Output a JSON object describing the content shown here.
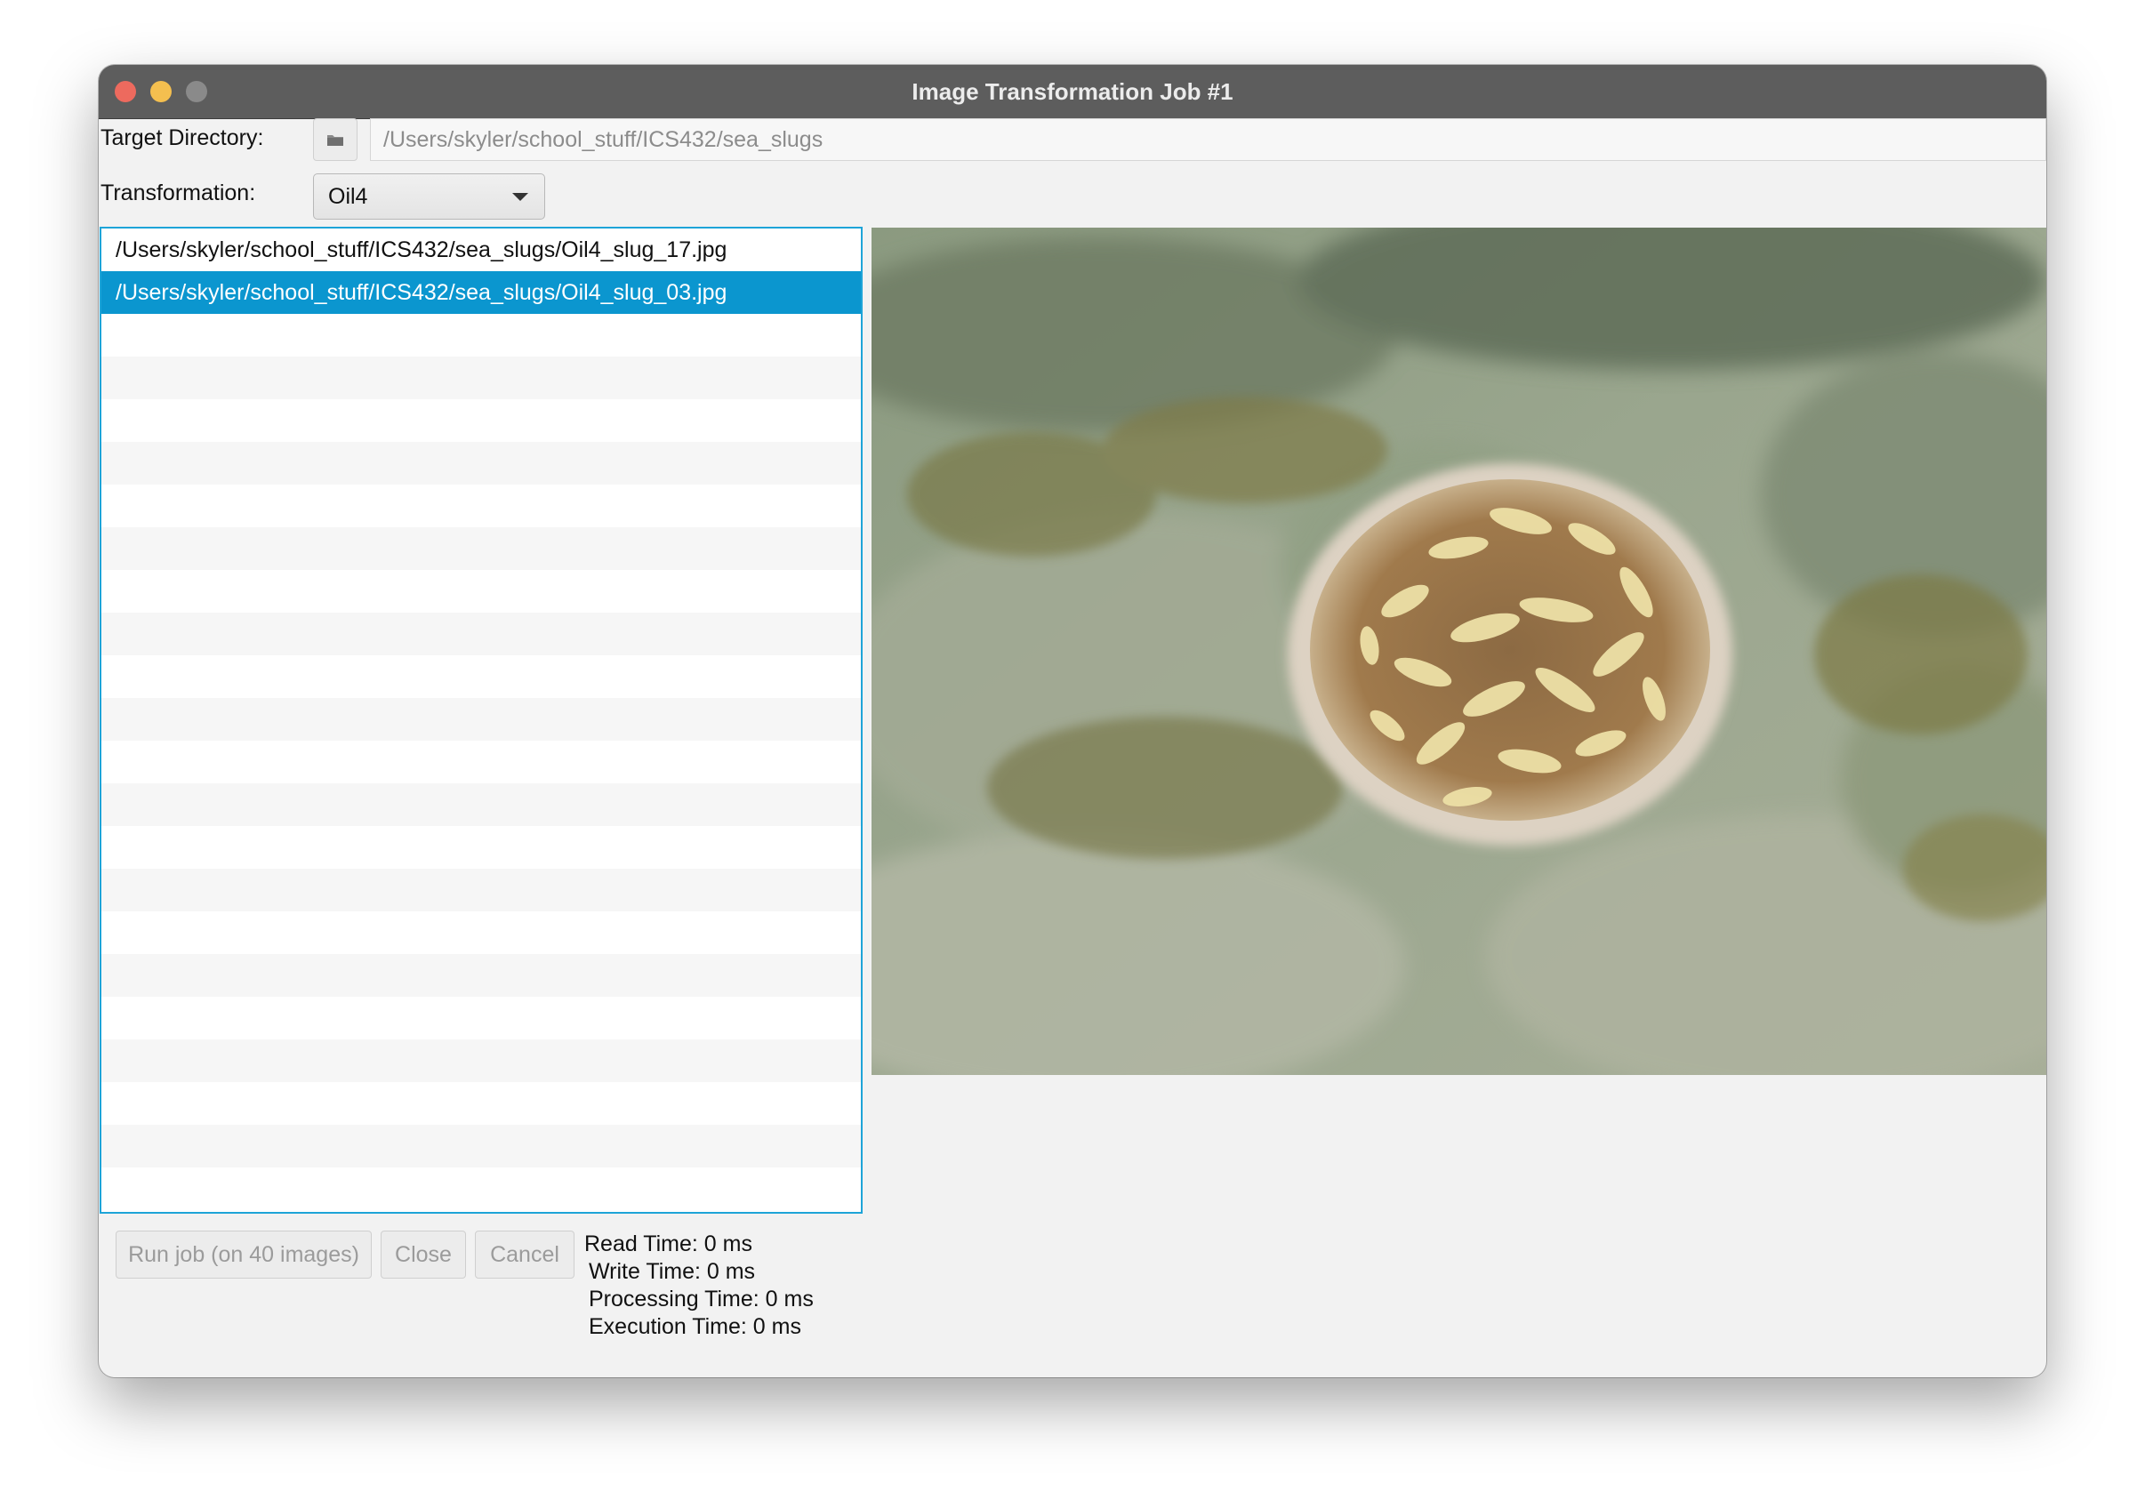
{
  "window": {
    "title": "Image Transformation Job #1"
  },
  "target_directory": {
    "label": "Target Directory:",
    "button_icon": "folder-icon",
    "value": "/Users/skyler/school_stuff/ICS432/sea_slugs"
  },
  "transformation": {
    "label": "Transformation:",
    "selected": "Oil4"
  },
  "file_list": {
    "items": [
      {
        "path": "/Users/skyler/school_stuff/ICS432/sea_slugs/Oil4_slug_17.jpg",
        "selected": false
      },
      {
        "path": "/Users/skyler/school_stuff/ICS432/sea_slugs/Oil4_slug_03.jpg",
        "selected": true
      }
    ]
  },
  "preview": {
    "image_alt": "sea-slug-photo"
  },
  "buttons": {
    "run": "Run job (on 40 images)",
    "close": "Close",
    "cancel": "Cancel"
  },
  "stats": {
    "read": "Read Time: 0 ms",
    "write": "Write Time: 0 ms",
    "processing": "Processing Time: 0 ms",
    "execution": "Execution Time: 0 ms"
  },
  "colors": {
    "accent": "#0b96cf",
    "list_border": "#1ea4d8",
    "titlebar": "#5d5d5d"
  }
}
